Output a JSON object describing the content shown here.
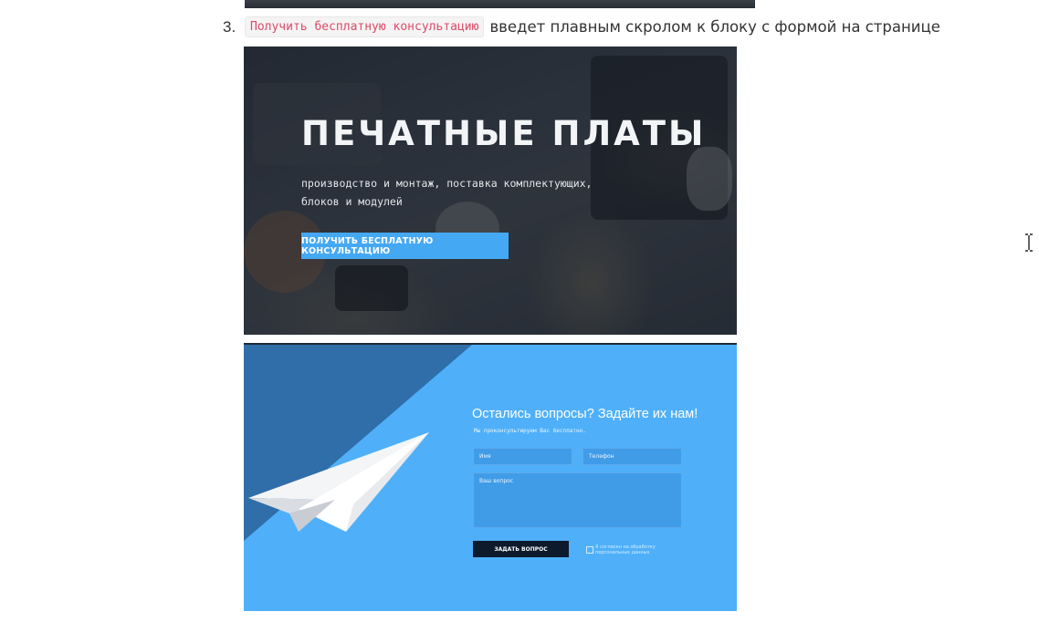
{
  "list_item": {
    "number": "3.",
    "code_label": "Получить бесплатную консультацию",
    "text": "введет плавным скролом к блоку с формой на странице"
  },
  "hero": {
    "title": "ПЕЧАТНЫЕ ПЛАТЫ",
    "subtitle": "производство и монтаж, поставка комплектующих, блоков и модулей",
    "button_label": "ПОЛУЧИТЬ БЕСПЛАТНУЮ КОНСУЛЬТАЦИЮ"
  },
  "form": {
    "title": "Остались вопросы? Задайте их нам!",
    "subtitle": "Мы проконсультируем Вас бесплатно.",
    "name_placeholder": "Имя",
    "phone_placeholder": "Телефон",
    "question_placeholder": "Ваш вопрос",
    "submit_label": "ЗАДАТЬ ВОПРОС",
    "consent_text": "Я согласен на обработку персональных данных"
  },
  "colors": {
    "code_text": "#dd4a68",
    "hero_button": "#45a8f2",
    "form_background": "#4fb0f9",
    "form_dark_triangle": "#2f6ea8",
    "submit_button": "#0c1a2c"
  },
  "icons": {
    "cursor": "text-cursor-icon",
    "plane": "paper-plane-icon"
  }
}
